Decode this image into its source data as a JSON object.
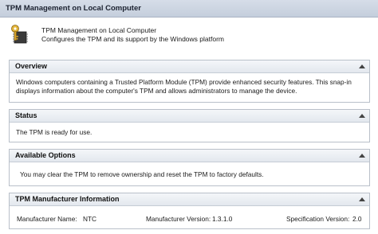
{
  "window": {
    "title": "TPM Management on Local Computer"
  },
  "header": {
    "icon": "key-chip-icon",
    "app_name": "TPM Management on Local Computer",
    "app_desc": "Configures the TPM and its support by the Windows platform"
  },
  "overview": {
    "title": "Overview",
    "line1": "Windows computers containing a Trusted Platform Module (TPM) provide enhanced security features. This snap-in",
    "line2": "displays information about the computer's TPM and allows administrators to manage the device."
  },
  "status": {
    "title": "Status",
    "text": "The TPM is ready for use."
  },
  "options": {
    "title": "Available Options",
    "text": "You may clear the TPM to remove ownership and reset the TPM to factory defaults."
  },
  "manufacturer": {
    "title": "TPM Manufacturer Information",
    "name_label": "Manufacturer Name:",
    "name_value": "NTC",
    "version_label": "Manufacturer Version:",
    "version_value": "1.3.1.0",
    "spec_label": "Specification Version:",
    "spec_value": "2.0"
  },
  "icons": {
    "collapse": "chevron-up-icon"
  },
  "colors": {
    "titlebar": "#c9d2df",
    "panel_border": "#b9c0c9",
    "panel_header": "#e8ecf1"
  }
}
